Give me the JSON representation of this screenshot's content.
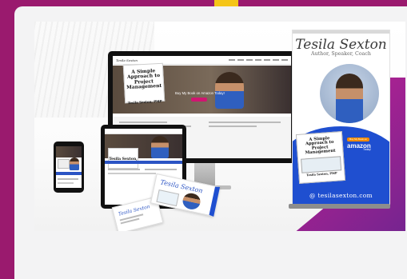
{
  "showcase": {
    "monitor": {
      "site_logo": "Tesila Sexton",
      "hero_text": "Buy My Book on Amazon Today!",
      "book_title": "A Simple Approach to Project Management",
      "book_author": "Tesila Sexton, PMP"
    },
    "tablet": {
      "book_author": "Tesila Sexton, PMP"
    },
    "business_card": {
      "name": "Tesila Sexton"
    },
    "banner": {
      "name": "Tesila Sexton",
      "tagline": "Author, Speaker, Coach",
      "book_title": "A Simple Approach to Project Management",
      "book_author": "Tesila Sexton, PMP",
      "buy_badge": "Buy My Book on",
      "amazon": "amazon",
      "today": "Today!",
      "url": "@ tesilasexton.com"
    }
  },
  "colors": {
    "page_background": "#9a1a6e",
    "accent_yellow": "#f5c518",
    "brand_blue": "#1f4fd0",
    "brand_magenta": "#c0148c"
  }
}
